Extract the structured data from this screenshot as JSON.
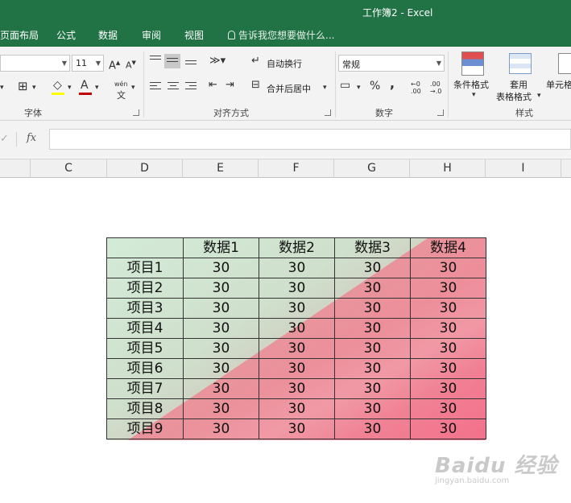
{
  "window": {
    "title": "工作簿2 - Excel"
  },
  "menu": {
    "tabs": [
      "页面布局",
      "公式",
      "数据",
      "审阅",
      "视图"
    ],
    "tell_me": "告诉我您想要做什么..."
  },
  "ribbon": {
    "font": {
      "size": "11",
      "grow": "A",
      "shrink": "A",
      "label": "字体",
      "phonetic": "wén"
    },
    "alignment": {
      "wrap_text": "自动换行",
      "merge_center": "合并后居中",
      "label": "对齐方式"
    },
    "number": {
      "format": "常规",
      "percent": "%",
      "comma": ",",
      "label": "数字"
    },
    "styles": {
      "conditional": "条件格式",
      "table_format_1": "套用",
      "table_format_2": "表格格式",
      "cell_styles": "单元格",
      "label": "样式"
    }
  },
  "formula_bar": {
    "fx": "fx",
    "value": ""
  },
  "columns": [
    "C",
    "D",
    "E",
    "F",
    "G",
    "H",
    "I"
  ],
  "table": {
    "header": [
      "",
      "数据1",
      "数据2",
      "数据3",
      "数据4"
    ],
    "rows": [
      [
        "项目1",
        "30",
        "30",
        "30",
        "30"
      ],
      [
        "项目2",
        "30",
        "30",
        "30",
        "30"
      ],
      [
        "项目3",
        "30",
        "30",
        "30",
        "30"
      ],
      [
        "项目4",
        "30",
        "30",
        "30",
        "30"
      ],
      [
        "项目5",
        "30",
        "30",
        "30",
        "30"
      ],
      [
        "项目6",
        "30",
        "30",
        "30",
        "30"
      ],
      [
        "项目7",
        "30",
        "30",
        "30",
        "30"
      ],
      [
        "项目8",
        "30",
        "30",
        "30",
        "30"
      ],
      [
        "项目9",
        "30",
        "30",
        "30",
        "30"
      ]
    ]
  },
  "watermark": {
    "brand": "Baidu 经验",
    "url": "jingyan.baidu.com"
  },
  "colors": {
    "excel_green": "#217346",
    "fill_green": "#d3ebd8",
    "fill_pink": "#f3708b",
    "font_color_red": "#c00000"
  }
}
